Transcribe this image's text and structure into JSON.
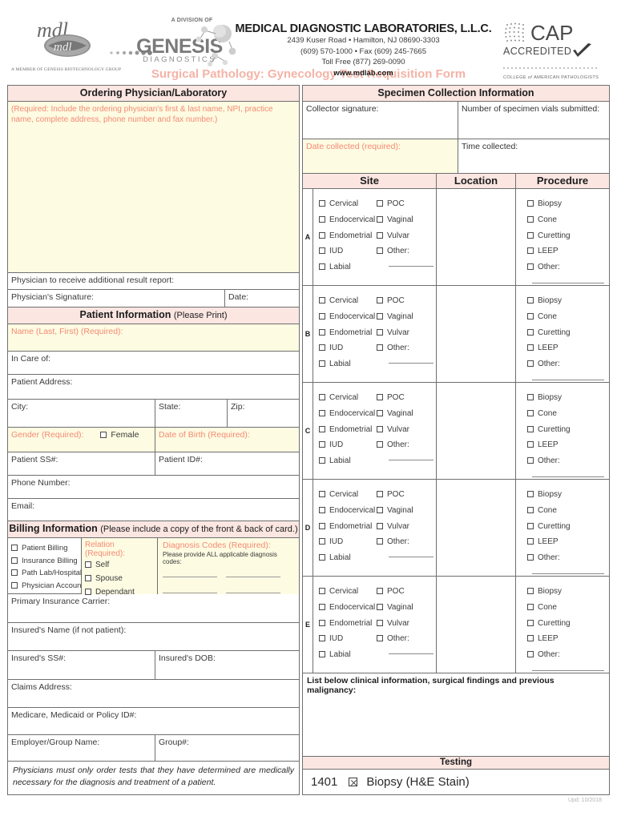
{
  "header": {
    "division_of": "A DIVISION OF",
    "genesis_word": "GENESIS",
    "genesis_sub": "DIAGNOSTICS",
    "member_line": "A MEMBER OF GENESIS BIOTECHNOLOGY GROUP",
    "lab_name": "MEDICAL DIAGNOSTIC LABORATORIES, L.L.C.",
    "address_line1": "2439 Kuser Road  •  Hamilton, NJ  08690-3303",
    "address_line2": "(609) 570-1000  •  Fax (609) 245-7665",
    "address_line3": "Toll Free (877) 269-0090",
    "website": "www.mdlab.com",
    "cap_word": "CAP",
    "cap_accredited": "ACCREDITED",
    "cap_footer_a": "COLLEGE ",
    "cap_footer_b": "of ",
    "cap_footer_c": "AMERICAN PATHOLOGISTS"
  },
  "form_title": "Surgical Pathology: Gynecology Test Requisition Form",
  "accent_color": "#f4b3a6",
  "required_color": "#f58a73",
  "band_color": "#fbe6e2",
  "highlight_color": "#fdfbe2",
  "ordering": {
    "band": "Ordering Physician/Laboratory",
    "required_note": "(Required: Include the ordering physician's first & last name, NPI, practice name, complete address, phone number and fax number.)",
    "additional_report": "Physician to receive additional result report:",
    "signature": "Physician's Signature:",
    "date": "Date:"
  },
  "patient": {
    "band_title": "Patient Information",
    "band_sub": "(Please Print)",
    "name": "Name (Last, First) (Required):",
    "in_care_of": "In Care of:",
    "address": "Patient Address:",
    "city": "City:",
    "state": "State:",
    "zip": "Zip:",
    "gender": "Gender (Required):",
    "gender_option": "Female",
    "dob": "Date of Birth (Required):",
    "ss": "Patient SS#:",
    "id": "Patient ID#:",
    "phone": "Phone Number:",
    "email": "Email:"
  },
  "billing": {
    "band_title": "Billing Information",
    "band_sub": "(Please include a copy of the front & back of card.)",
    "options": [
      "Patient Billing",
      "Insurance Billing",
      "Path Lab/Hospital",
      "Physician Account"
    ],
    "relation_label": "Relation (Required):",
    "relation_options": [
      "Self",
      "Spouse",
      "Dependant"
    ],
    "diagnosis_label": "Diagnosis Codes (Required):",
    "diagnosis_note": "Please provide ALL applicable diagnosis codes:",
    "primary_carrier": "Primary Insurance Carrier:",
    "insured_name": "Insured's Name (if not patient):",
    "insured_ss": "Insured's SS#:",
    "insured_dob": "Insured's DOB:",
    "claims_address": "Claims Address:",
    "policy_id": "Medicare, Medicaid or Policy ID#:",
    "employer": "Employer/Group Name:",
    "group_number": "Group#:",
    "legal_note": "Physicians must only order tests that they have determined are medically necessary for the diagnosis and treatment of a patient."
  },
  "specimen": {
    "band": "Specimen Collection Information",
    "collector_signature": "Collector signature:",
    "vials": "Number of specimen vials submitted:",
    "date_collected": "Date collected (required):",
    "time_collected": "Time collected:"
  },
  "site_table": {
    "headers": {
      "site": "Site",
      "location": "Location",
      "procedure": "Procedure"
    },
    "row_letters": [
      "A",
      "B",
      "C",
      "D",
      "E"
    ],
    "site_col1": [
      "Cervical",
      "Endocervical",
      "Endometrial",
      "IUD",
      "Labial"
    ],
    "site_col2": [
      "POC",
      "Vaginal",
      "Vulvar",
      "Other:"
    ],
    "procedures": [
      "Biopsy",
      "Cone",
      "Curetting",
      "LEEP",
      "Other:"
    ]
  },
  "clinical": {
    "prompt": "List below clinical information, surgical findings and previous malignancy:"
  },
  "testing": {
    "band": "Testing",
    "code": "1401",
    "label": "Biopsy (H&E Stain)",
    "checked": true
  },
  "footer": {
    "updated": "Upd: 10/2018"
  }
}
